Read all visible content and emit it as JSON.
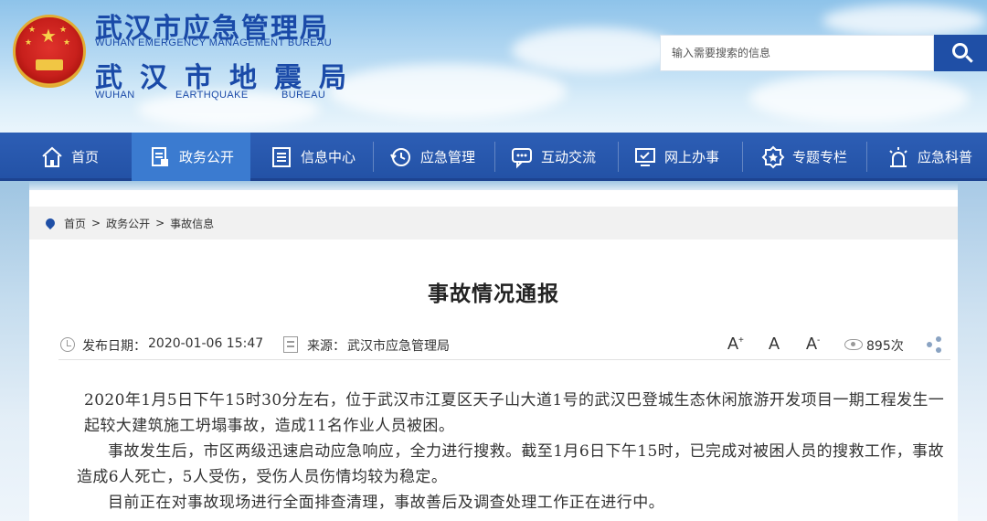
{
  "header": {
    "title_cn_1": "武汉市应急管理局",
    "title_en_1": "WUHAN EMERGENCY MANAGEMENT BUREAU",
    "title_cn_2": "武汉市地震局",
    "title_en_2_parts": [
      "WUHAN",
      "EARTHQUAKE",
      "BUREAU"
    ],
    "search_placeholder": "输入需要搜索的信息",
    "brand_color": "#1f4fa6"
  },
  "nav": {
    "items": [
      {
        "label": "首页",
        "icon": "home-icon"
      },
      {
        "label": "政务公开",
        "icon": "document-icon",
        "active": true
      },
      {
        "label": "信息中心",
        "icon": "list-icon"
      },
      {
        "label": "应急管理",
        "icon": "history-icon"
      },
      {
        "label": "互动交流",
        "icon": "chat-icon"
      },
      {
        "label": "网上办事",
        "icon": "monitor-icon"
      },
      {
        "label": "专题专栏",
        "icon": "star-badge-icon"
      },
      {
        "label": "应急科普",
        "icon": "alarm-icon"
      }
    ]
  },
  "breadcrumb": {
    "items": [
      "首页",
      "政务公开",
      "事故信息"
    ],
    "separator": ">"
  },
  "article": {
    "title": "事故情况通报",
    "publish_label": "发布日期：",
    "publish_date": "2020-01-06 15:47",
    "source_label": "来源：",
    "source": "武汉市应急管理局",
    "font_controls": [
      "A+",
      "A",
      "A-"
    ],
    "views": "895次",
    "paragraphs": [
      "2020年1月5日下午15时30分左右，位于武汉市江夏区天子山大道1号的武汉巴登城生态休闲旅游开发项目一期工程发生一起较大建筑施工坍塌事故，造成11名作业人员被困。",
      "事故发生后，市区两级迅速启动应急响应，全力进行搜救。截至1月6日下午15时，已完成对被困人员的搜救工作，事故造成6人死亡，5人受伤，受伤人员伤情均较为稳定。",
      "目前正在对事故现场进行全面排查清理，事故善后及调查处理工作正在进行中。"
    ]
  }
}
